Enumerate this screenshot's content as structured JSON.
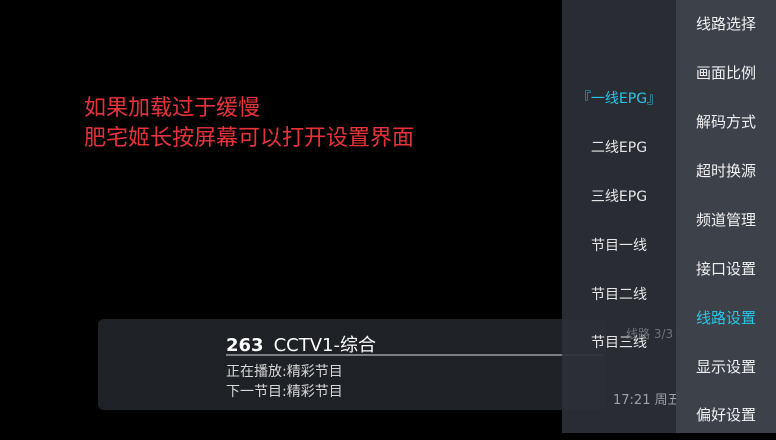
{
  "hint": {
    "line1": "如果加载过于缓慢",
    "line2": "肥宅姬长按屏幕可以打开设置界面"
  },
  "info_bar": {
    "channel_number": "263",
    "channel_name": "CCTV1-综合",
    "now_label": "正在播放:",
    "now_program": "精彩节目",
    "next_label": "下一节目:",
    "next_program": "精彩节目",
    "progress": 1.0
  },
  "line_panel": {
    "items": [
      {
        "label": "『一线EPG』",
        "active": true
      },
      {
        "label": "二线EPG",
        "active": false
      },
      {
        "label": "三线EPG",
        "active": false
      },
      {
        "label": "节目一线",
        "active": false
      },
      {
        "label": "节目二线",
        "active": false
      },
      {
        "label": "节目三线",
        "active": false
      }
    ],
    "line_count": "线路 3/3",
    "clock": "17:21 周五"
  },
  "settings_menu": {
    "items": [
      {
        "label": "线路选择",
        "active": false
      },
      {
        "label": "画面比例",
        "active": false
      },
      {
        "label": "解码方式",
        "active": false
      },
      {
        "label": "超时换源",
        "active": false
      },
      {
        "label": "频道管理",
        "active": false
      },
      {
        "label": "接口设置",
        "active": false
      },
      {
        "label": "线路设置",
        "active": true
      },
      {
        "label": "显示设置",
        "active": false
      },
      {
        "label": "偏好设置",
        "active": false
      }
    ]
  },
  "colors": {
    "hint_text": "#e8323a",
    "accent": "#29c5e6"
  }
}
